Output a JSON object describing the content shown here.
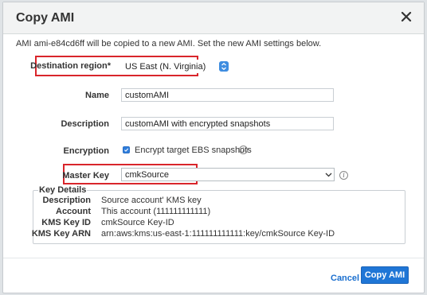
{
  "dialog": {
    "title": "Copy AMI",
    "intro": "AMI ami-e84cd6ff will be copied to a new AMI. Set the new AMI settings below."
  },
  "form": {
    "destination_region_label": "Destination region*",
    "destination_region_value": "US East (N. Virginia)",
    "name_label": "Name",
    "name_value": "customAMI",
    "description_label": "Description",
    "description_value": "customAMI with encrypted snapshots",
    "encryption_label": "Encryption",
    "encryption_checkbox_label": "Encrypt target EBS snapshots",
    "encryption_checked": true,
    "master_key_label": "Master Key",
    "master_key_value": "cmkSource"
  },
  "key_details": {
    "legend": "Key Details",
    "rows": [
      {
        "label": "Description",
        "value": "Source account' KMS key"
      },
      {
        "label": "Account",
        "value": "This account (111111111111)"
      },
      {
        "label": "KMS Key ID",
        "value": "cmkSource Key-ID"
      },
      {
        "label": "KMS Key ARN",
        "value": "arn:aws:kms:us-east-1:111111111111:key/cmkSource Key-ID"
      }
    ]
  },
  "footer": {
    "cancel_label": "Cancel",
    "primary_label": "Copy AMI"
  },
  "colors": {
    "highlight": "#d9252b",
    "accent": "#1f76d6",
    "link": "#1a6fcf"
  },
  "icons": [
    "close-icon",
    "info-icon",
    "checkbox-checked-icon",
    "dropdown-chevron-icon",
    "select-spinner-icon"
  ]
}
